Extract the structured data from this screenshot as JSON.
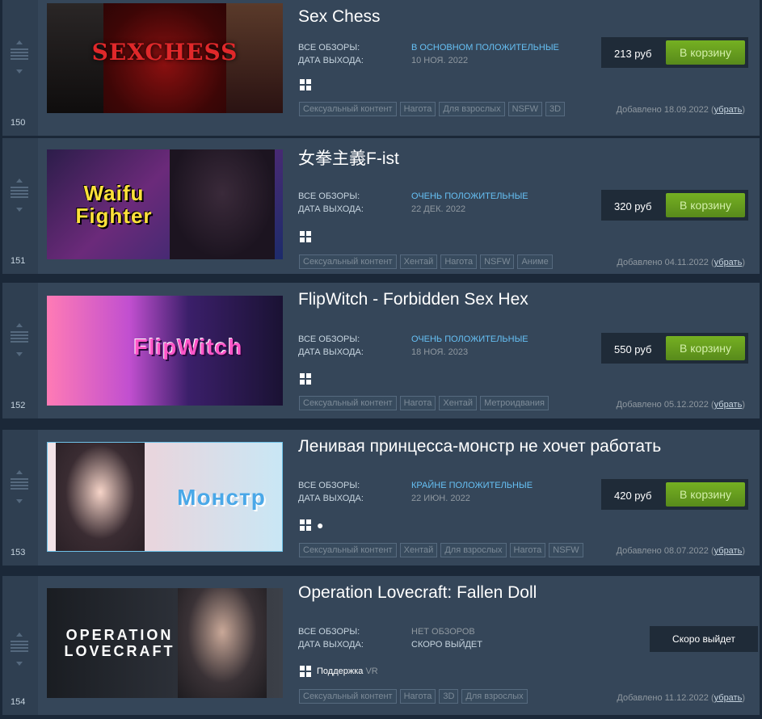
{
  "labels": {
    "reviews": "ВСЕ ОБЗОРЫ:",
    "release": "ДАТА ВЫХОДА:",
    "cart": "В корзину",
    "added": "Добавлено",
    "remove": "убрать",
    "vr_bold": "Поддержка",
    "vr": "VR"
  },
  "items": [
    {
      "rank": "150",
      "title": "Sex Chess",
      "review": "В ОСНОВНОМ ПОЛОЖИТЕЛЬНЫЕ",
      "date": "10 НОЯ. 2022",
      "price": "213 руб",
      "tags": [
        "Сексуальный контент",
        "Нагота",
        "Для взрослых",
        "NSFW",
        "3D"
      ],
      "added_date": "18.09.2022",
      "capsule_logo": "SEXCHESS",
      "platform_icons": [
        "windows-icon"
      ]
    },
    {
      "rank": "151",
      "title": "女拳主義F-ist",
      "review": "ОЧЕНЬ ПОЛОЖИТЕЛЬНЫЕ",
      "date": "22 ДЕК. 2022",
      "price": "320 руб",
      "tags": [
        "Сексуальный контент",
        "Хентай",
        "Нагота",
        "NSFW",
        "Аниме"
      ],
      "added_date": "04.11.2022",
      "capsule_logo": "Waifu Fighter",
      "platform_icons": [
        "windows-icon"
      ]
    },
    {
      "rank": "152",
      "title": "FlipWitch - Forbidden Sex Hex",
      "review": "ОЧЕНЬ ПОЛОЖИТЕЛЬНЫЕ",
      "date": "18 НОЯ. 2023",
      "price": "550 руб",
      "tags": [
        "Сексуальный контент",
        "Нагота",
        "Хентай",
        "Метроидвания"
      ],
      "added_date": "05.12.2022",
      "capsule_logo": "FlipWitch",
      "platform_icons": [
        "windows-icon"
      ]
    },
    {
      "rank": "153",
      "title": "Ленивая принцесса-монстр не хочет работать",
      "review": "КРАЙНЕ ПОЛОЖИТЕЛЬНЫЕ",
      "date": "22 ИЮН. 2022",
      "price": "420 руб",
      "tags": [
        "Сексуальный контент",
        "Хентай",
        "Для взрослых",
        "Нагота",
        "NSFW"
      ],
      "added_date": "08.07.2022",
      "capsule_logo": "Монстр",
      "platform_icons": [
        "windows-icon",
        "apple-icon"
      ]
    },
    {
      "rank": "154",
      "title": "Operation Lovecraft: Fallen Doll",
      "review": "НЕТ ОБЗОРОВ",
      "date": "СКОРО ВЫЙДЕТ",
      "soon_button": "Скоро выйдет",
      "tags": [
        "Сексуальный контент",
        "Нагота",
        "3D",
        "Для взрослых"
      ],
      "added_date": "11.12.2022",
      "capsule_logo": "OPERATION LOVECRAFT",
      "platform_icons": [
        "windows-icon"
      ]
    }
  ],
  "colors": {
    "page_bg": "#1b2838",
    "row_bg": "#354659",
    "review_positive": "#66c0f4",
    "cart_green": "#75b022"
  }
}
